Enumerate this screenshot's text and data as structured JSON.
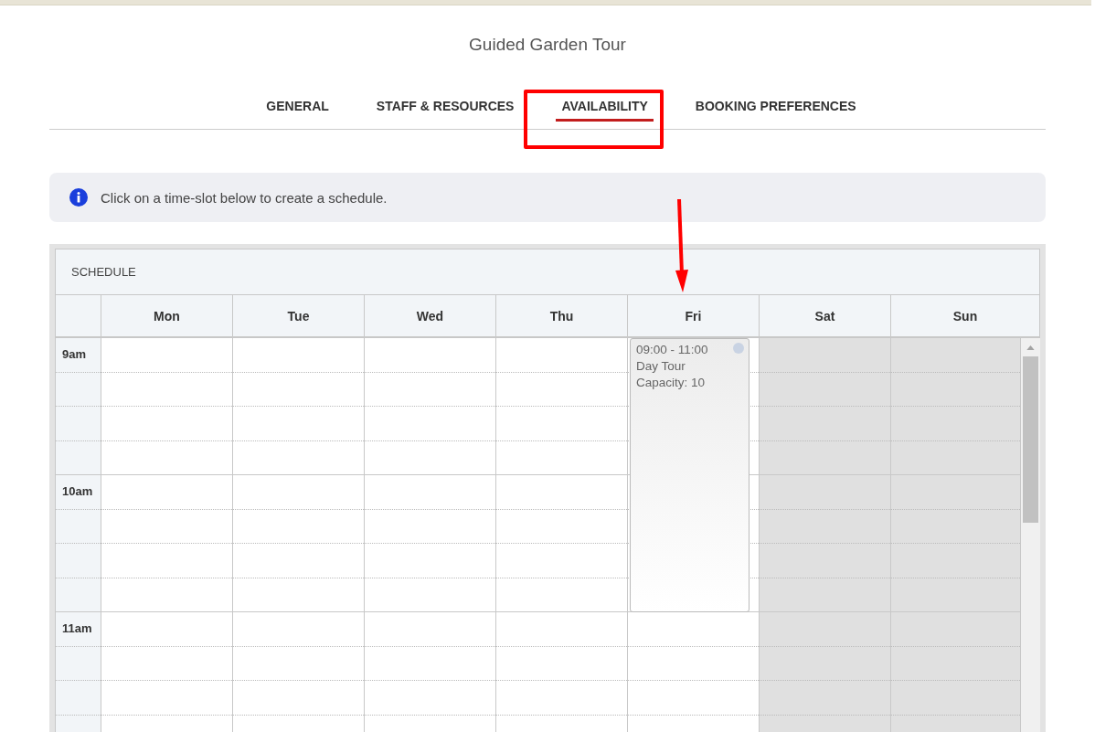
{
  "page": {
    "title": "Guided Garden Tour"
  },
  "tabs": [
    {
      "label": "GENERAL",
      "selected": false
    },
    {
      "label": "STAFF & RESOURCES",
      "selected": false
    },
    {
      "label": "AVAILABILITY",
      "selected": true
    },
    {
      "label": "BOOKING PREFERENCES",
      "selected": false
    }
  ],
  "info": {
    "text": "Click on a time-slot below to create a schedule."
  },
  "schedule": {
    "title": "SCHEDULE",
    "hours": [
      "9am",
      "10am",
      "11am"
    ],
    "days": [
      {
        "label": "Mon",
        "disabled": false
      },
      {
        "label": "Tue",
        "disabled": false
      },
      {
        "label": "Wed",
        "disabled": false
      },
      {
        "label": "Thu",
        "disabled": false
      },
      {
        "label": "Fri",
        "disabled": false,
        "events": [
          {
            "time": "09:00 - 11:00",
            "title": "Day Tour",
            "capacity": "Capacity: 10"
          }
        ]
      },
      {
        "label": "Sat",
        "disabled": true
      },
      {
        "label": "Sun",
        "disabled": true
      }
    ]
  }
}
